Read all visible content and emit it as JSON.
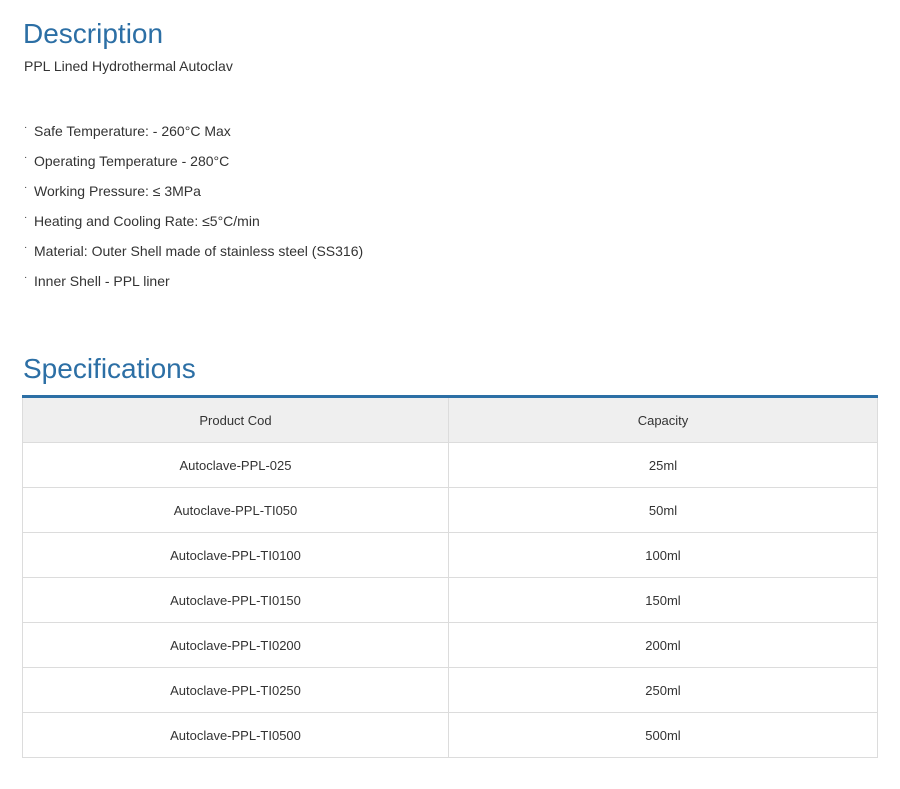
{
  "description": {
    "title": "Description",
    "subtitle": "PPL Lined Hydrothermal Autoclav",
    "bullet": "·",
    "features": [
      "Safe Temperature: - 260°C Max",
      "Operating Temperature - 280°C",
      "Working Pressure: ≤ 3MPa",
      "Heating and Cooling Rate: ≤5°C/min",
      "Material: Outer Shell made of stainless steel (SS316)",
      "Inner Shell - PPL liner"
    ]
  },
  "specifications": {
    "title": "Specifications",
    "columns": [
      "Product Cod",
      "Capacity"
    ],
    "rows": [
      [
        "Autoclave-PPL-025",
        "25ml"
      ],
      [
        "Autoclave-PPL-TI050",
        "50ml"
      ],
      [
        "Autoclave-PPL-TI0100",
        "100ml"
      ],
      [
        "Autoclave-PPL-TI0150",
        "150ml"
      ],
      [
        "Autoclave-PPL-TI0200",
        "200ml"
      ],
      [
        "Autoclave-PPL-TI0250",
        "250ml"
      ],
      [
        "Autoclave-PPL-TI0500",
        "500ml"
      ]
    ]
  },
  "colors": {
    "heading": "#2c6fa5",
    "table_accent": "#2c6fa5",
    "header_bg": "#efefef",
    "border": "#dcdcdc"
  }
}
